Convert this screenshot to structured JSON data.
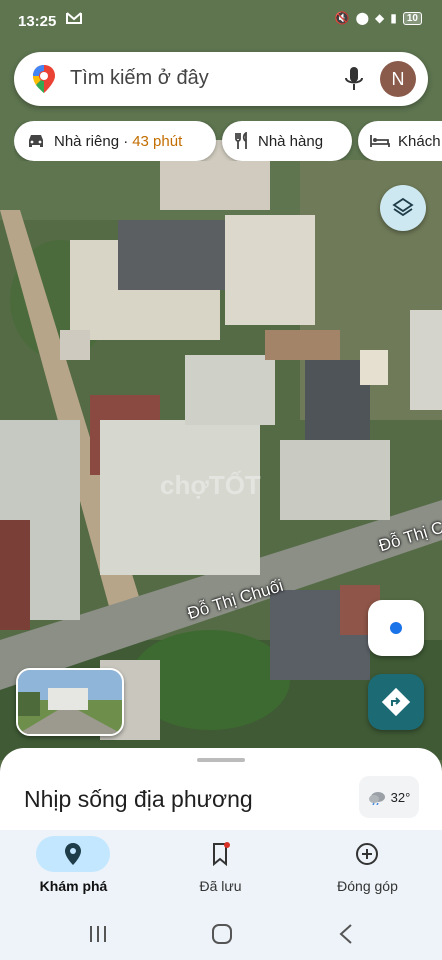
{
  "status": {
    "time": "13:25",
    "battery": "10"
  },
  "search": {
    "placeholder": "Tìm kiếm ở đây",
    "avatar_letter": "N"
  },
  "chips": [
    {
      "label": "Nhà riêng ·",
      "eta": "43 phút",
      "icon": "car-icon"
    },
    {
      "label": "Nhà hàng",
      "icon": "restaurant-icon"
    },
    {
      "label": "Khách",
      "icon": "hotel-icon"
    }
  ],
  "map": {
    "street_labels": [
      "Đỗ Thị Chuối",
      "Đỗ Thị C"
    ],
    "watermark": "chợTỐT"
  },
  "sheet": {
    "title": "Nhịp sống địa phương",
    "temperature": "32°",
    "weather_icon": "cloudy-icon"
  },
  "bottom_nav": [
    {
      "label": "Khám phá",
      "icon": "explore-pin-icon",
      "active": true
    },
    {
      "label": "Đã lưu",
      "icon": "bookmark-icon",
      "active": false
    },
    {
      "label": "Đóng góp",
      "icon": "add-circle-icon",
      "active": false
    }
  ],
  "colors": {
    "accent": "#1a73e8",
    "eta": "#c26d00",
    "directions_fab": "#1c6b74",
    "nav_active": "#c3e7ff"
  }
}
